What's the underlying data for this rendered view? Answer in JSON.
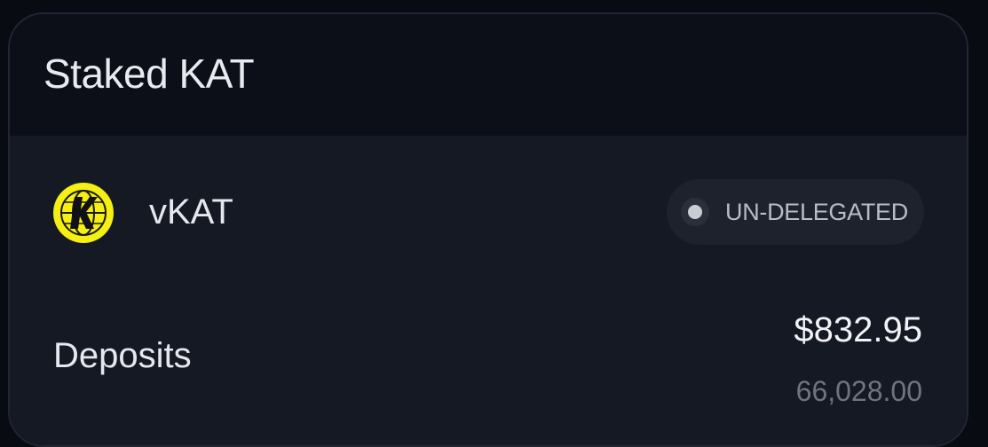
{
  "card": {
    "title": "Staked KAT"
  },
  "token": {
    "symbol": "vKAT",
    "logo_icon": "kat-globe-logo-icon",
    "logo_letter": "K",
    "logo_color": "#f5ef13"
  },
  "status": {
    "label": "UN-DELEGATED",
    "dot_color": "#c9ccd3"
  },
  "deposits": {
    "label": "Deposits",
    "usd_value": "$832.95",
    "token_amount": "66,028.00"
  }
}
